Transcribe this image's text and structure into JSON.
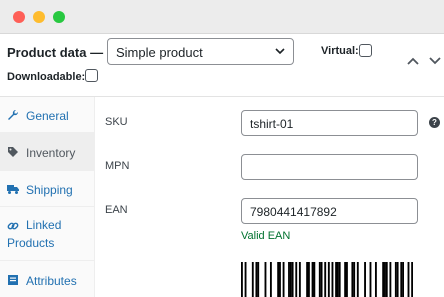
{
  "window": {
    "controls": [
      "close",
      "minimize",
      "zoom"
    ]
  },
  "header": {
    "product_data_label": "Product data —",
    "product_type": {
      "selected": "Simple product"
    },
    "virtual_label": "Virtual:",
    "virtual_checked": false,
    "downloadable_label": "Downloadable:",
    "downloadable_checked": false
  },
  "sidebar": {
    "items": [
      {
        "label": "General",
        "icon": "wrench-icon",
        "active": false
      },
      {
        "label": "Inventory",
        "icon": "tag-icon",
        "active": true
      },
      {
        "label": "Shipping",
        "icon": "truck-icon",
        "active": false
      },
      {
        "label": "Linked Products",
        "icon": "link-icon",
        "active": false
      },
      {
        "label": "Attributes",
        "icon": "list-icon",
        "active": false
      }
    ]
  },
  "fields": {
    "sku": {
      "label": "SKU",
      "value": "tshirt-01"
    },
    "mpn": {
      "label": "MPN",
      "value": ""
    },
    "ean": {
      "label": "EAN",
      "value": "7980441417892",
      "status": "Valid EAN"
    }
  },
  "colors": {
    "link": "#2271b1",
    "valid": "#00722f"
  }
}
